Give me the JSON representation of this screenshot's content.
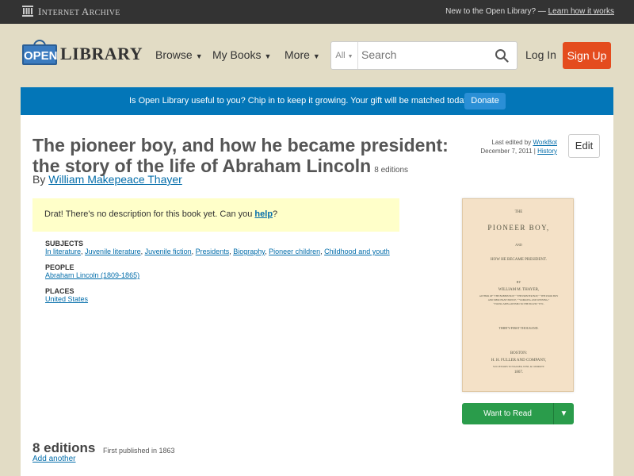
{
  "ia_bar": {
    "name_first": "I",
    "name_rest": "NTERNET ",
    "name_a": "A",
    "name_rest2": "RCHIVE",
    "new_text": "New to the Open Library? — ",
    "learn_link": "Learn how it works"
  },
  "header": {
    "logo_badge": "OPEN",
    "logo_word": "LIBRARY",
    "nav": [
      {
        "label": "Browse"
      },
      {
        "label": "My Books"
      },
      {
        "label": "More"
      }
    ],
    "search_scope": "All",
    "search_placeholder": "Search",
    "login": "Log In",
    "signup": "Sign Up"
  },
  "donate": {
    "text": "Is Open Library useful to you? Chip in to keep it growing. Your gift will be matched today!",
    "button": "Donate"
  },
  "book": {
    "title": "The pioneer boy, and how he became president: the story of the life of Abraham Lincoln",
    "editions_badge": "8 editions",
    "by": "By ",
    "author": "William Makepeace Thayer",
    "last_edited_prefix": "Last edited by ",
    "last_edited_by": "WorkBot",
    "last_edited_date": "December 7, 2011 | ",
    "history": "History",
    "edit": "Edit",
    "desc_pre": "Drat! There's no description for this book yet. Can you ",
    "desc_link": "help",
    "desc_post": "?",
    "subjects_label": "SUBJECTS",
    "subjects": [
      "In literature",
      "Juvenile literature",
      "Juvenile fiction",
      "Presidents",
      "Biography",
      "Pioneer children",
      "Childhood and youth"
    ],
    "people_label": "PEOPLE",
    "people": [
      "Abraham Lincoln (1809-1865)"
    ],
    "places_label": "PLACES",
    "places": [
      "United States"
    ],
    "cover": {
      "the": "THE",
      "title": "PIONEER BOY,",
      "and": "AND",
      "subtitle": "HOW HE BECAME PRESIDENT.",
      "by": "BY",
      "author": "WILLIAM M. THAYER,",
      "author_note1": "AUTHOR OF “THE BOBBIN BOY,” “THE PRINTER BOY,” “THE POOR BOY",
      "author_note2": "AND MERCHANT PRINCE,” “WORKING AND WINNING,”",
      "author_note3": "“YOUNG MEN ADVISED TO THE PULPIT,” ETC.",
      "edition": "THIRTY-FIRST THOUSAND.",
      "city": "BOSTON:",
      "publisher": "H. H. FULLER AND COMPANY,",
      "publisher_note": "SUCCESSORS TO WALKER, WISE, & COMPANY.",
      "year": "1867."
    },
    "want_to_read": "Want to Read",
    "editions_heading": "8 editions",
    "first_published": "First published in 1863",
    "add_another": "Add another"
  }
}
